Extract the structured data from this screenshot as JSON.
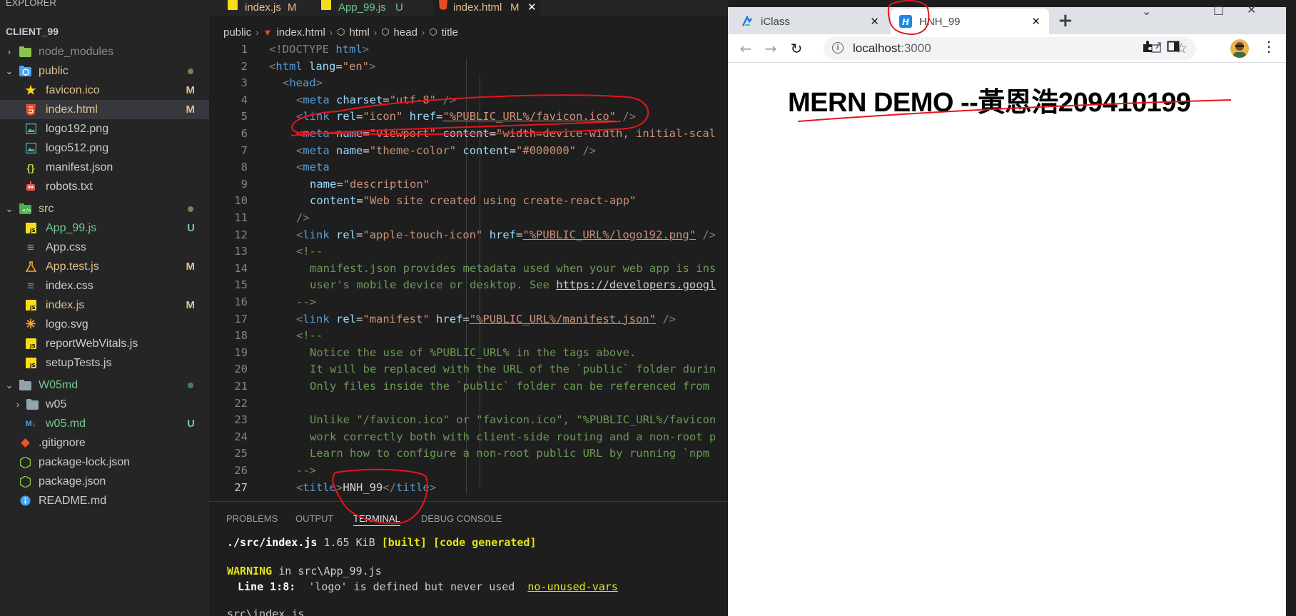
{
  "explorer": {
    "header": "EXPLORER",
    "project": "CLIENT_99",
    "items": [
      {
        "name": "node_modules"
      },
      {
        "name": "public"
      },
      {
        "name": "favicon.ico",
        "badge": "M"
      },
      {
        "name": "index.html",
        "badge": "M"
      },
      {
        "name": "logo192.png"
      },
      {
        "name": "logo512.png"
      },
      {
        "name": "manifest.json"
      },
      {
        "name": "robots.txt"
      },
      {
        "name": "src"
      },
      {
        "name": "App_99.js",
        "badge": "U"
      },
      {
        "name": "App.css"
      },
      {
        "name": "App.test.js",
        "badge": "M"
      },
      {
        "name": "index.css"
      },
      {
        "name": "index.js",
        "badge": "M"
      },
      {
        "name": "logo.svg"
      },
      {
        "name": "reportWebVitals.js"
      },
      {
        "name": "setupTests.js"
      },
      {
        "name": "W05md"
      },
      {
        "name": "w05"
      },
      {
        "name": "w05.md",
        "badge": "U"
      },
      {
        "name": ".gitignore"
      },
      {
        "name": "package-lock.json"
      },
      {
        "name": "package.json"
      },
      {
        "name": "README.md"
      }
    ]
  },
  "editor_tabs": [
    {
      "label": "index.js",
      "status": "M"
    },
    {
      "label": "App_99.js",
      "status": "U"
    },
    {
      "label": "index.html",
      "status": "M"
    }
  ],
  "breadcrumb": [
    "public",
    "index.html",
    "html",
    "head",
    "title"
  ],
  "code_lines": [
    {
      "n": "1"
    },
    {
      "n": "2"
    },
    {
      "n": "3"
    },
    {
      "n": "4"
    },
    {
      "n": "5"
    },
    {
      "n": "6"
    },
    {
      "n": "7"
    },
    {
      "n": "8"
    },
    {
      "n": "9"
    },
    {
      "n": "10"
    },
    {
      "n": "11"
    },
    {
      "n": "12"
    },
    {
      "n": "13"
    },
    {
      "n": "14"
    },
    {
      "n": "15"
    },
    {
      "n": "16"
    },
    {
      "n": "17"
    },
    {
      "n": "18"
    },
    {
      "n": "19"
    },
    {
      "n": "20"
    },
    {
      "n": "21"
    },
    {
      "n": "22"
    },
    {
      "n": "23"
    },
    {
      "n": "24"
    },
    {
      "n": "25"
    },
    {
      "n": "26"
    },
    {
      "n": "27"
    }
  ],
  "code": {
    "l1_doctype": "<!DOCTYPE ",
    "l1_html": "html",
    "l1_close": ">",
    "l2_tag": "html",
    "l2_attr": "lang",
    "l2_val": "\"en\"",
    "l3_tag": "head",
    "l4_tag": "meta",
    "l4_attr": "charset",
    "l4_val": "\"utf-8\"",
    "l5_tag": "link",
    "l5_attr1": "rel",
    "l5_val1": "\"icon\"",
    "l5_attr2": "href",
    "l5_val2": "\"%PUBLIC_URL%/favicon.ico\"",
    "l6_tag": "meta",
    "l6_attr1": "name",
    "l6_val1": "\"viewport\"",
    "l6_attr2": "content",
    "l6_val2": "\"width=device-width, initial-scal",
    "l7_tag": "meta",
    "l7_attr1": "name",
    "l7_val1": "\"theme-color\"",
    "l7_attr2": "content",
    "l7_val2": "\"#000000\"",
    "l8_tag": "meta",
    "l9_attr": "name",
    "l9_val": "\"description\"",
    "l10_attr": "content",
    "l10_val": "\"Web site created using create-react-app\"",
    "l11": "/>",
    "l12_tag": "link",
    "l12_attr1": "rel",
    "l12_val1": "\"apple-touch-icon\"",
    "l12_attr2": "href",
    "l12_val2": "\"%PUBLIC_URL%/logo192.png\"",
    "l12_end": " />",
    "l13": "<!--",
    "l14": "manifest.json provides metadata used when your web app is ins",
    "l15a": "user's mobile device or desktop. See ",
    "l15b": "https://developers.googl",
    "l16": "-->",
    "l17_tag": "link",
    "l17_attr1": "rel",
    "l17_val1": "\"manifest\"",
    "l17_attr2": "href",
    "l17_val2": "\"%PUBLIC_URL%/manifest.json\"",
    "l18": "<!--",
    "l19": "Notice the use of %PUBLIC_URL% in the tags above.",
    "l20": "It will be replaced with the URL of the `public` folder durin",
    "l21": "Only files inside the `public` folder can be referenced from",
    "l23": "Unlike \"/favicon.ico\" or \"favicon.ico\", \"%PUBLIC_URL%/favicon",
    "l24": "work correctly both with client-side routing and a non-root p",
    "l25": "Learn how to configure a non-root public URL by running `npm",
    "l26": "-->",
    "l27_tag": "title",
    "l27_text": "HNH_99",
    "l27_close": "title"
  },
  "panel": {
    "tabs": [
      "PROBLEMS",
      "OUTPUT",
      "TERMINAL",
      "DEBUG CONSOLE"
    ],
    "t1_file": "./src/index.js",
    "t1_size": " 1.65 KiB ",
    "t1_built": "[built]",
    "t1_gen": "[code generated]",
    "t2_warn": "WARNING",
    "t2_rest": " in src\\App_99.js",
    "t3_loc": "Line 1:8:",
    "t3_msg": "  'logo' is defined but never used  ",
    "t3_rule": "no-unused-vars",
    "t4": "src\\index.js"
  },
  "chrome": {
    "tabs": [
      {
        "title": "iClass"
      },
      {
        "title": "HNH_99"
      }
    ],
    "url_host": "localhost",
    "url_port": ":3000",
    "page_heading": "MERN DEMO --黃恩浩209410199"
  },
  "colors": {
    "annotation_red": "#e8141c",
    "vscode_bg": "#1e1e1e",
    "sidebar_bg": "#252526"
  }
}
